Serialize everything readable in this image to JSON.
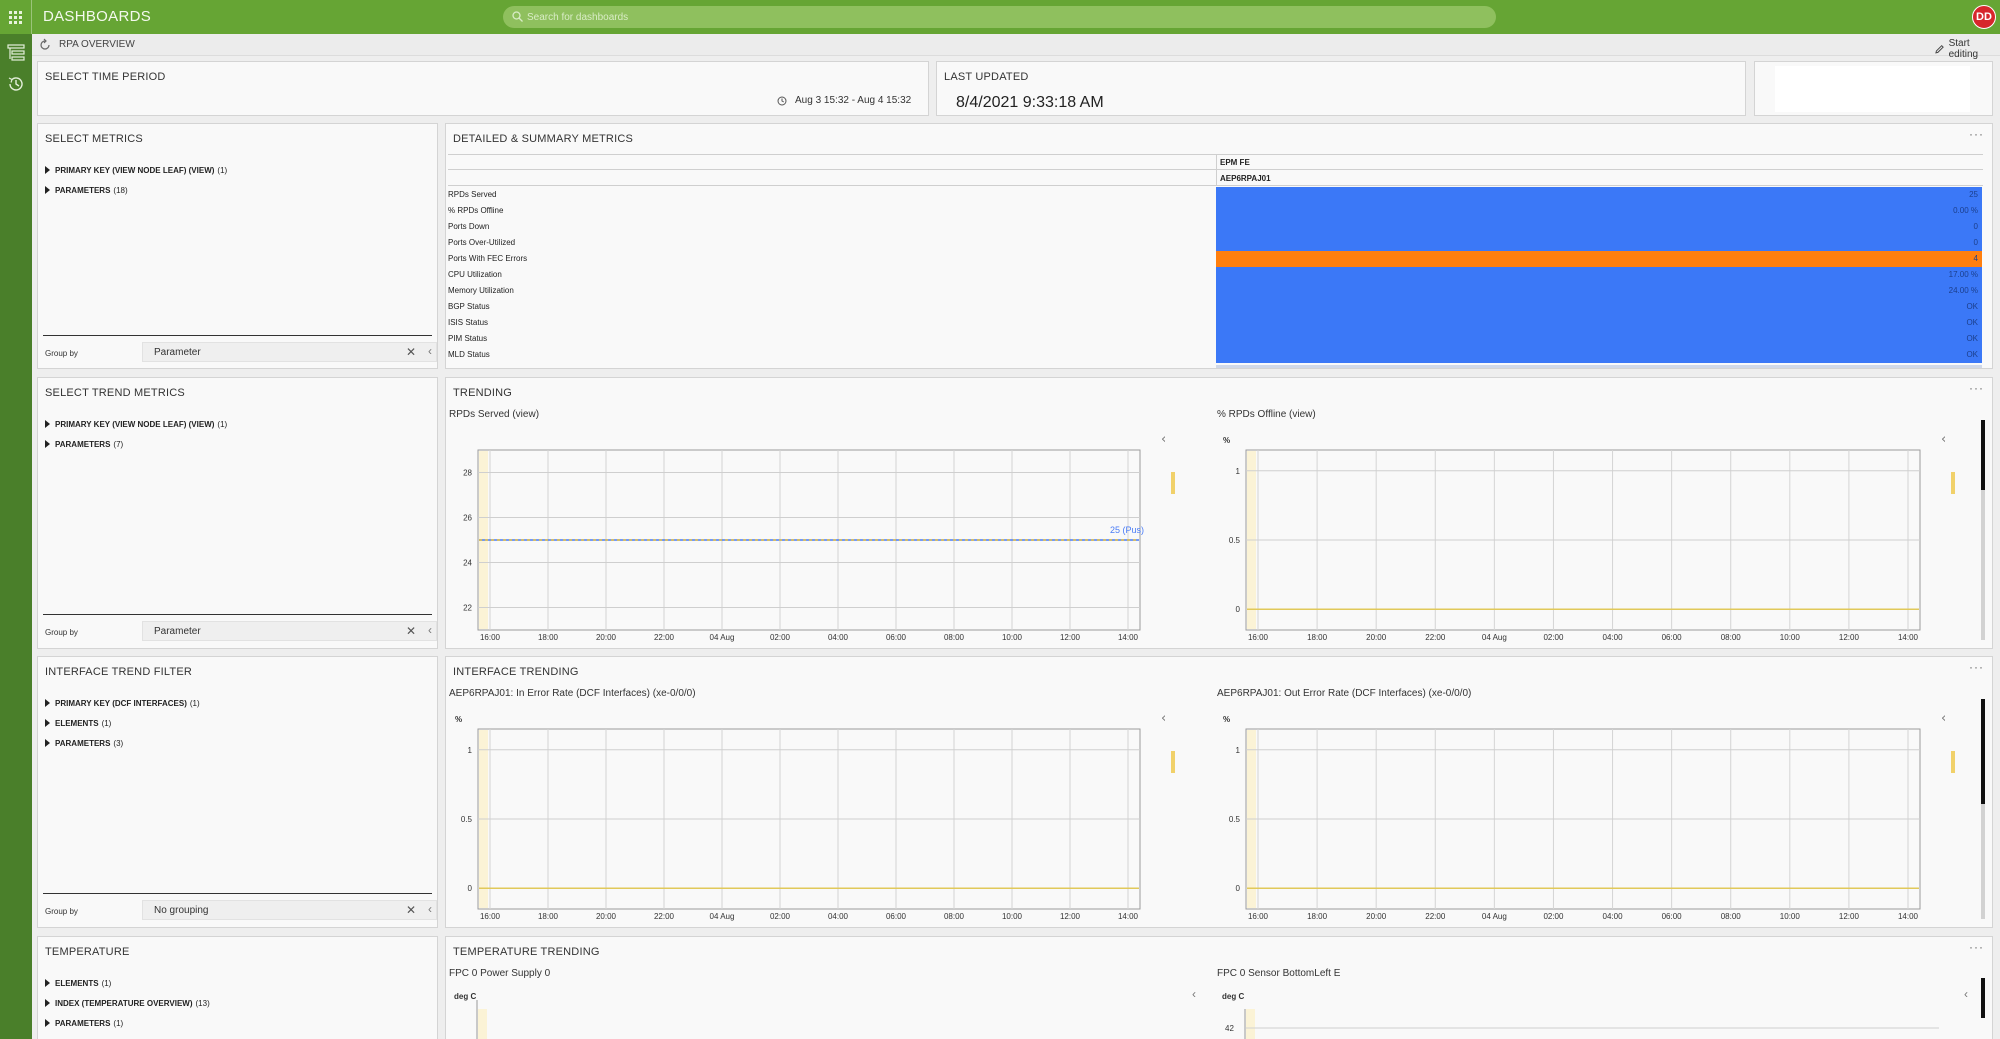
{
  "header": {
    "app_title": "DASHBOARDS",
    "search_placeholder": "Search for dashboards",
    "user_initials": "DD"
  },
  "subheader": {
    "page_name": "RPA OVERVIEW",
    "start_editing": "Start editing"
  },
  "time_period": {
    "title": "SELECT TIME PERIOD",
    "range": "Aug 3 15:32 - Aug 4 15:32"
  },
  "last_updated": {
    "title": "LAST UPDATED",
    "value": "8/4/2021 9:33:18 AM"
  },
  "select_metrics": {
    "title": "SELECT METRICS",
    "items": [
      {
        "label": "PRIMARY KEY (VIEW NODE LEAF) (VIEW)",
        "count": "(1)"
      },
      {
        "label": "PARAMETERS",
        "count": "(18)"
      }
    ],
    "group_by_label": "Group by",
    "group_by_value": "Parameter"
  },
  "detailed_metrics": {
    "title": "DETAILED & SUMMARY METRICS",
    "column_group": "EPM FE",
    "column": "AEP6RPAJ01",
    "rows": [
      {
        "label": "RPDs Served",
        "value": "25",
        "color": "#3b78f7"
      },
      {
        "label": "% RPDs Offline",
        "value": "0.00 %",
        "color": "#3b78f7"
      },
      {
        "label": "Ports Down",
        "value": "0",
        "color": "#3b78f7"
      },
      {
        "label": "Ports Over-Utilized",
        "value": "0",
        "color": "#3b78f7"
      },
      {
        "label": "Ports With FEC Errors",
        "value": "4",
        "color": "#ff7f0e"
      },
      {
        "label": "CPU Utilization",
        "value": "17.00 %",
        "color": "#3b78f7"
      },
      {
        "label": "Memory Utilization",
        "value": "24.00 %",
        "color": "#3b78f7"
      },
      {
        "label": "BGP Status",
        "value": "OK",
        "color": "#3b78f7"
      },
      {
        "label": "ISIS Status",
        "value": "OK",
        "color": "#3b78f7"
      },
      {
        "label": "PIM Status",
        "value": "OK",
        "color": "#3b78f7"
      },
      {
        "label": "MLD Status",
        "value": "OK",
        "color": "#3b78f7"
      }
    ]
  },
  "select_trend_metrics": {
    "title": "SELECT TREND METRICS",
    "items": [
      {
        "label": "PRIMARY KEY (VIEW NODE LEAF) (VIEW)",
        "count": "(1)"
      },
      {
        "label": "PARAMETERS",
        "count": "(7)"
      }
    ],
    "group_by_label": "Group by",
    "group_by_value": "Parameter"
  },
  "trending": {
    "title": "TRENDING",
    "charts": [
      {
        "title": "RPDs Served (view)"
      },
      {
        "title": "% RPDs Offline (view)"
      }
    ]
  },
  "interface_trend_filter": {
    "title": "INTERFACE TREND FILTER",
    "items": [
      {
        "label": "PRIMARY KEY (DCF INTERFACES)",
        "count": "(1)"
      },
      {
        "label": "ELEMENTS",
        "count": "(1)"
      },
      {
        "label": "PARAMETERS",
        "count": "(3)"
      }
    ],
    "group_by_label": "Group by",
    "group_by_value": "No grouping"
  },
  "interface_trending": {
    "title": "INTERFACE TRENDING",
    "charts": [
      {
        "title": "AEP6RPAJ01: In Error Rate (DCF Interfaces) (xe-0/0/0)"
      },
      {
        "title": "AEP6RPAJ01: Out Error Rate (DCF Interfaces) (xe-0/0/0)"
      }
    ]
  },
  "temperature": {
    "title": "TEMPERATURE",
    "items": [
      {
        "label": "ELEMENTS",
        "count": "(1)"
      },
      {
        "label": "INDEX (TEMPERATURE OVERVIEW)",
        "count": "(13)"
      },
      {
        "label": "PARAMETERS",
        "count": "(1)"
      }
    ]
  },
  "temperature_trending": {
    "title": "TEMPERATURE TRENDING",
    "charts": [
      {
        "title": "FPC 0 Power Supply 0",
        "unit": "deg C"
      },
      {
        "title": "FPC 0 Sensor BottomLeft E",
        "unit": "deg C",
        "first_tick": "42"
      }
    ]
  },
  "x_ticks": [
    "16:00",
    "18:00",
    "20:00",
    "22:00",
    "04 Aug",
    "02:00",
    "04:00",
    "06:00",
    "08:00",
    "10:00",
    "12:00",
    "14:00"
  ],
  "chart_data": [
    {
      "type": "line",
      "title": "RPDs Served (view)",
      "x": [
        "16:00",
        "18:00",
        "20:00",
        "22:00",
        "04 Aug",
        "02:00",
        "04:00",
        "06:00",
        "08:00",
        "10:00",
        "12:00",
        "14:00"
      ],
      "series": [
        {
          "values": [
            25,
            25,
            25,
            25,
            25,
            25,
            25,
            25,
            25,
            25,
            25,
            25
          ]
        }
      ],
      "y_ticks": [
        "22",
        "24",
        "26",
        "28"
      ],
      "ylim": [
        21,
        29
      ],
      "annotation": "25 (Pus)",
      "line_color": "#4a7cf6",
      "dash_color": "#e1bd3f"
    },
    {
      "type": "line",
      "title": "% RPDs Offline (view)",
      "ylabel": "%",
      "x": [
        "16:00",
        "18:00",
        "20:00",
        "22:00",
        "04 Aug",
        "02:00",
        "04:00",
        "06:00",
        "08:00",
        "10:00",
        "12:00",
        "14:00"
      ],
      "series": [
        {
          "values": [
            0,
            0,
            0,
            0,
            0,
            0,
            0,
            0,
            0,
            0,
            0,
            0
          ]
        }
      ],
      "y_ticks": [
        "0",
        "0.5",
        "1"
      ],
      "ylim": [
        -0.15,
        1.15
      ],
      "line_color": "#e1c95a"
    },
    {
      "type": "line",
      "title": "AEP6RPAJ01: In Error Rate (DCF Interfaces) (xe-0/0/0)",
      "ylabel": "%",
      "x": [
        "16:00",
        "18:00",
        "20:00",
        "22:00",
        "04 Aug",
        "02:00",
        "04:00",
        "06:00",
        "08:00",
        "10:00",
        "12:00",
        "14:00"
      ],
      "series": [
        {
          "values": [
            0,
            0,
            0,
            0,
            0,
            0,
            0,
            0,
            0,
            0,
            0,
            0
          ]
        }
      ],
      "y_ticks": [
        "0",
        "0.5",
        "1"
      ],
      "ylim": [
        -0.15,
        1.15
      ],
      "line_color": "#e1c95a"
    },
    {
      "type": "line",
      "title": "AEP6RPAJ01: Out Error Rate (DCF Interfaces) (xe-0/0/0)",
      "ylabel": "%",
      "x": [
        "16:00",
        "18:00",
        "20:00",
        "22:00",
        "04 Aug",
        "02:00",
        "04:00",
        "06:00",
        "08:00",
        "10:00",
        "12:00",
        "14:00"
      ],
      "series": [
        {
          "values": [
            0,
            0,
            0,
            0,
            0,
            0,
            0,
            0,
            0,
            0,
            0,
            0
          ]
        }
      ],
      "y_ticks": [
        "0",
        "0.5",
        "1"
      ],
      "ylim": [
        -0.15,
        1.15
      ],
      "line_color": "#e1c95a"
    }
  ]
}
